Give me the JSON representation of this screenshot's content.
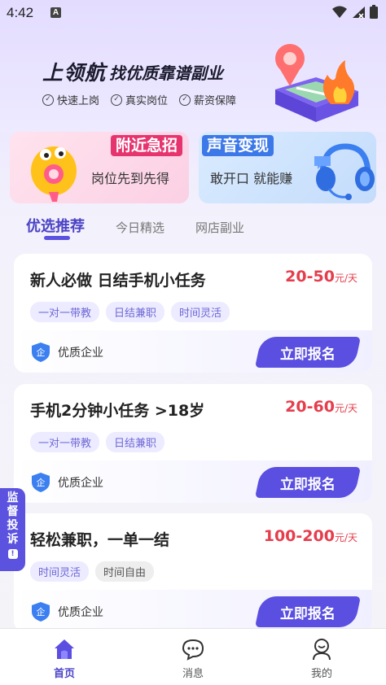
{
  "status_bar": {
    "time": "4:42",
    "notification": "A"
  },
  "hero": {
    "brand": "上领航",
    "slogan": "找优质靠谱副业",
    "features": [
      "快速上岗",
      "真实岗位",
      "薪资保障"
    ]
  },
  "banners": {
    "left": {
      "tag": "附近急招",
      "subtitle": "岗位先到先得"
    },
    "right": {
      "tag": "声音变现",
      "subtitle": "敢开口 就能赚"
    }
  },
  "tabs": [
    "优选推荐",
    "今日精选",
    "网店副业"
  ],
  "jobs": [
    {
      "title": "新人必做 日结手机小任务",
      "salary": "20-50",
      "unit": "元/天",
      "tags": [
        "一对一带教",
        "日结兼职",
        "时间灵活"
      ],
      "company": "优质企业",
      "apply": "立即报名"
    },
    {
      "title": "手机2分钟小任务 >18岁",
      "salary": "20-60",
      "unit": "元/天",
      "tags": [
        "一对一带教",
        "日结兼职"
      ],
      "company": "优质企业",
      "apply": "立即报名"
    },
    {
      "title": "轻松兼职，一单一结",
      "salary": "100-200",
      "unit": "元/天",
      "tags": [
        "时间灵活",
        "时间自由"
      ],
      "company": "优质企业",
      "apply": "立即报名"
    }
  ],
  "complaint": {
    "label": [
      "监",
      "督",
      "投",
      "诉"
    ]
  },
  "bottom_nav": [
    "首页",
    "消息",
    "我的"
  ],
  "colors": {
    "accent": "#5a4fe0",
    "salary": "#e63d4c",
    "banner_left_tag": "#e6346f",
    "banner_right_tag": "#3c78e8"
  }
}
